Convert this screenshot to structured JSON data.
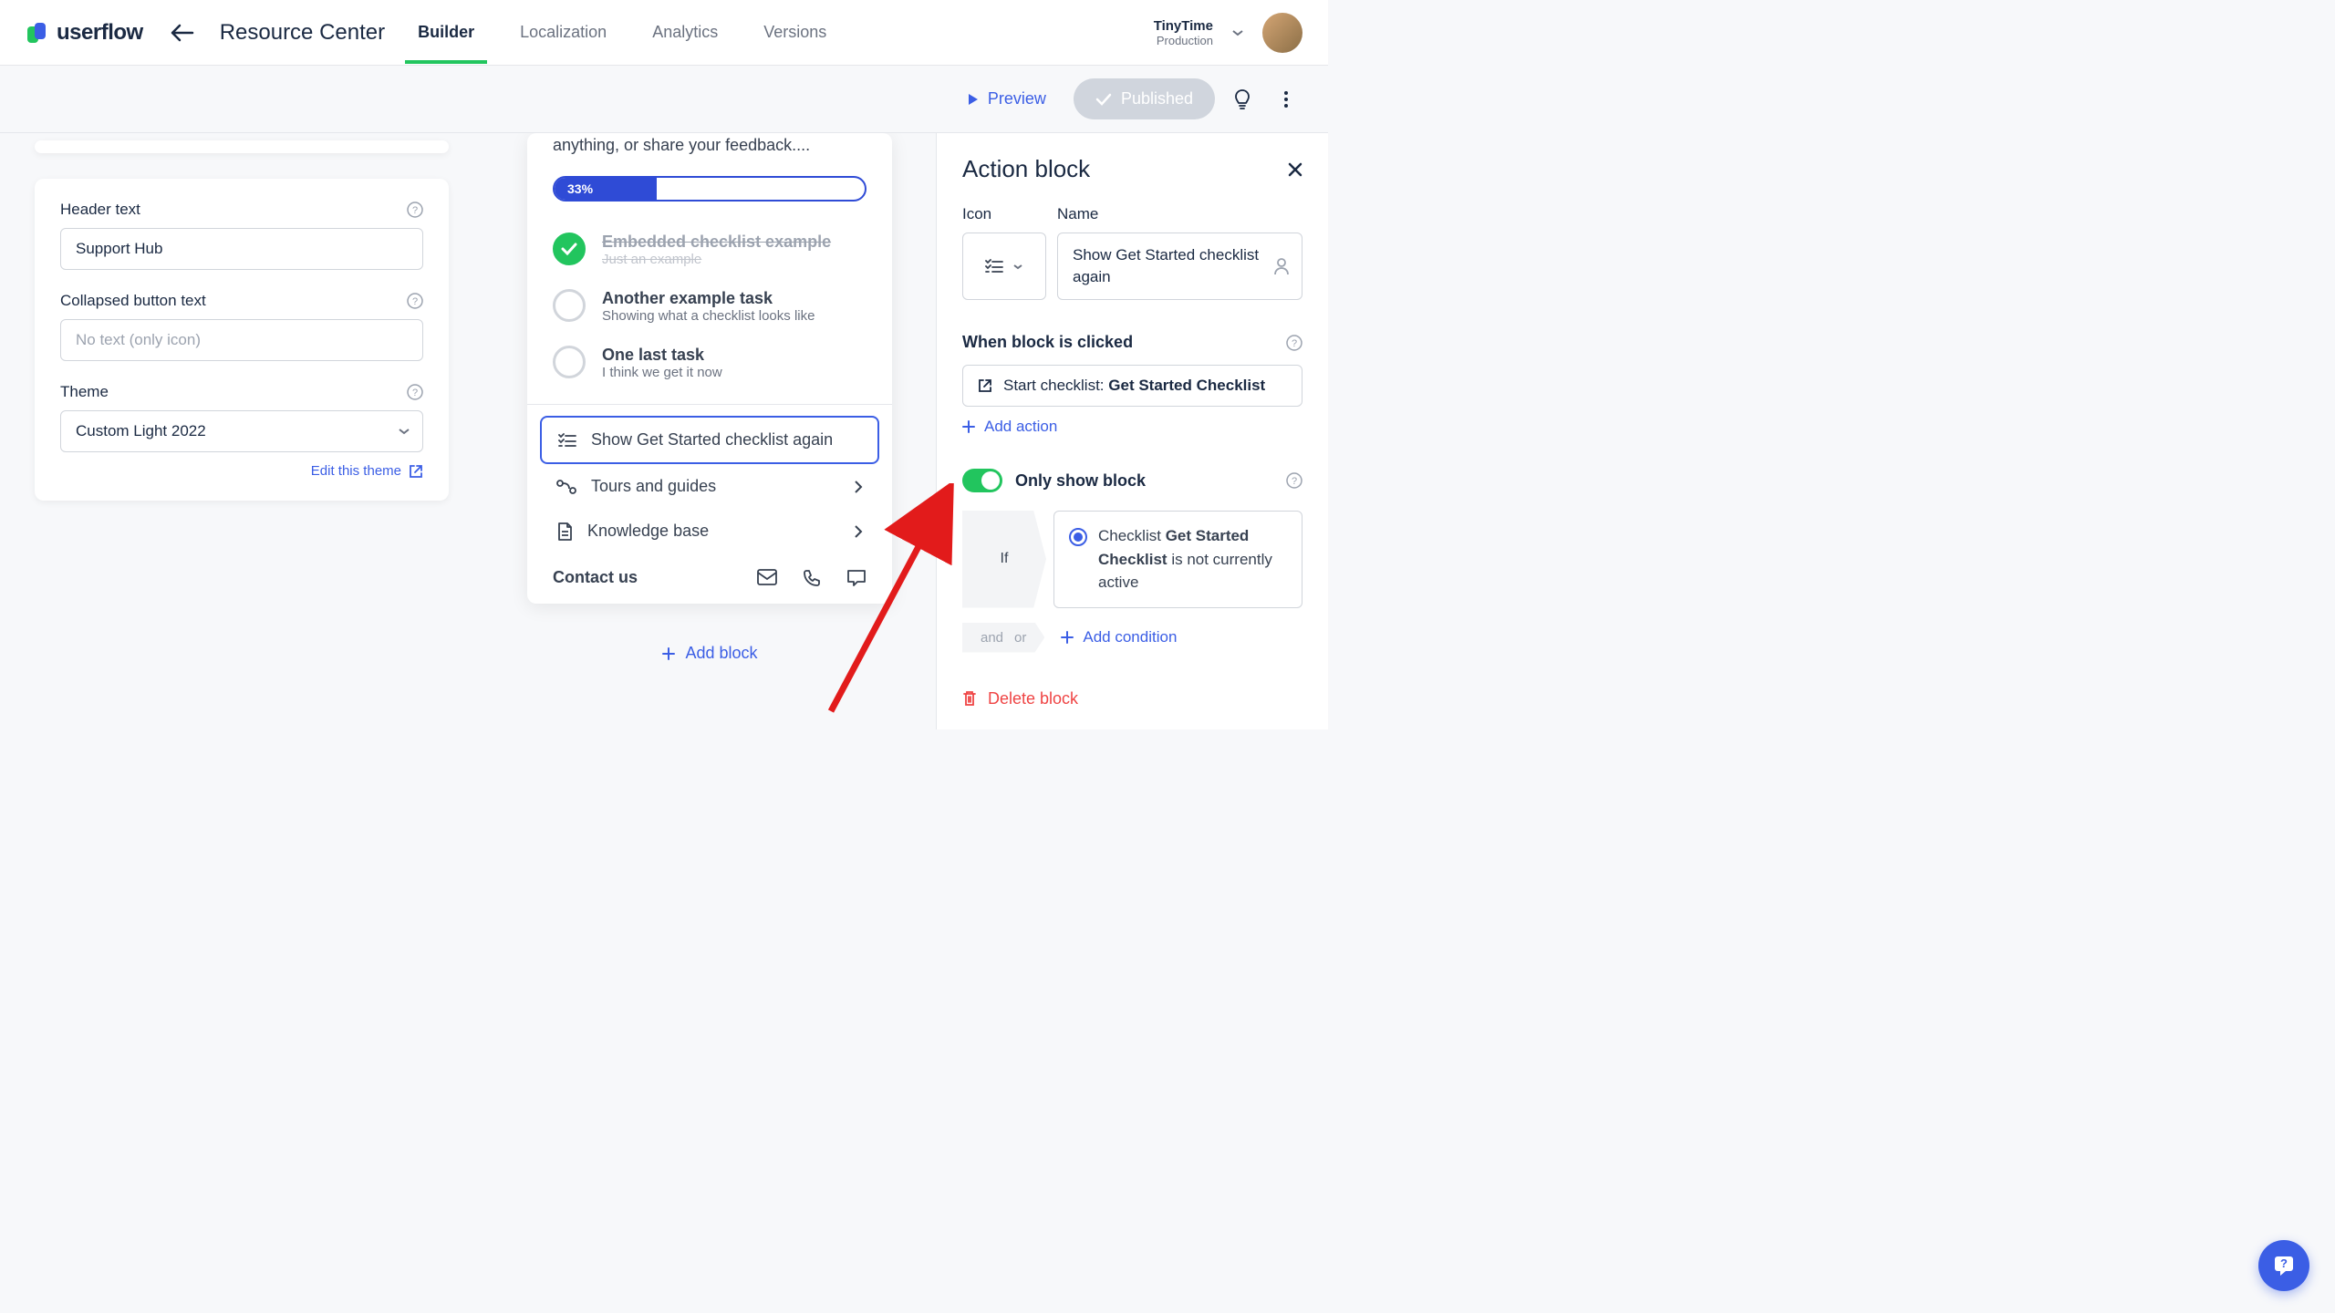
{
  "header": {
    "logo_text": "userflow",
    "page_title": "Resource Center",
    "tabs": [
      "Builder",
      "Localization",
      "Analytics",
      "Versions"
    ],
    "active_tab": 0,
    "workspace": {
      "name": "TinyTime",
      "env": "Production"
    }
  },
  "subbar": {
    "preview": "Preview",
    "published": "Published"
  },
  "left": {
    "header_text_label": "Header text",
    "header_text_value": "Support Hub",
    "collapsed_label": "Collapsed button text",
    "collapsed_placeholder": "No text (only icon)",
    "theme_label": "Theme",
    "theme_value": "Custom Light 2022",
    "edit_theme": "Edit this theme"
  },
  "center": {
    "intro": "anything, or share your feedback....",
    "progress": "33%",
    "checklist": [
      {
        "title": "Embedded checklist example",
        "sub": "Just an example",
        "done": true
      },
      {
        "title": "Another example task",
        "sub": "Showing what a checklist looks like",
        "done": false
      },
      {
        "title": "One last task",
        "sub": "I think we get it now",
        "done": false
      }
    ],
    "actions": [
      {
        "label": "Show Get Started checklist again",
        "selected": true,
        "chevron": false
      },
      {
        "label": "Tours and guides",
        "selected": false,
        "chevron": true
      },
      {
        "label": "Knowledge base",
        "selected": false,
        "chevron": true
      }
    ],
    "contact_label": "Contact us",
    "add_block": "Add block"
  },
  "right": {
    "title": "Action block",
    "icon_label": "Icon",
    "name_label": "Name",
    "name_value": "Show Get Started checklist again",
    "when_clicked": "When block is clicked",
    "action_prefix": "Start checklist: ",
    "action_target": "Get Started Checklist",
    "add_action": "Add action",
    "only_show": "Only show block",
    "if_label": "If",
    "cond_prefix": "Checklist ",
    "cond_bold": "Get Started Checklist",
    "cond_suffix": " is not currently active",
    "and": "and",
    "or": "or",
    "add_condition": "Add condition",
    "delete": "Delete block"
  }
}
